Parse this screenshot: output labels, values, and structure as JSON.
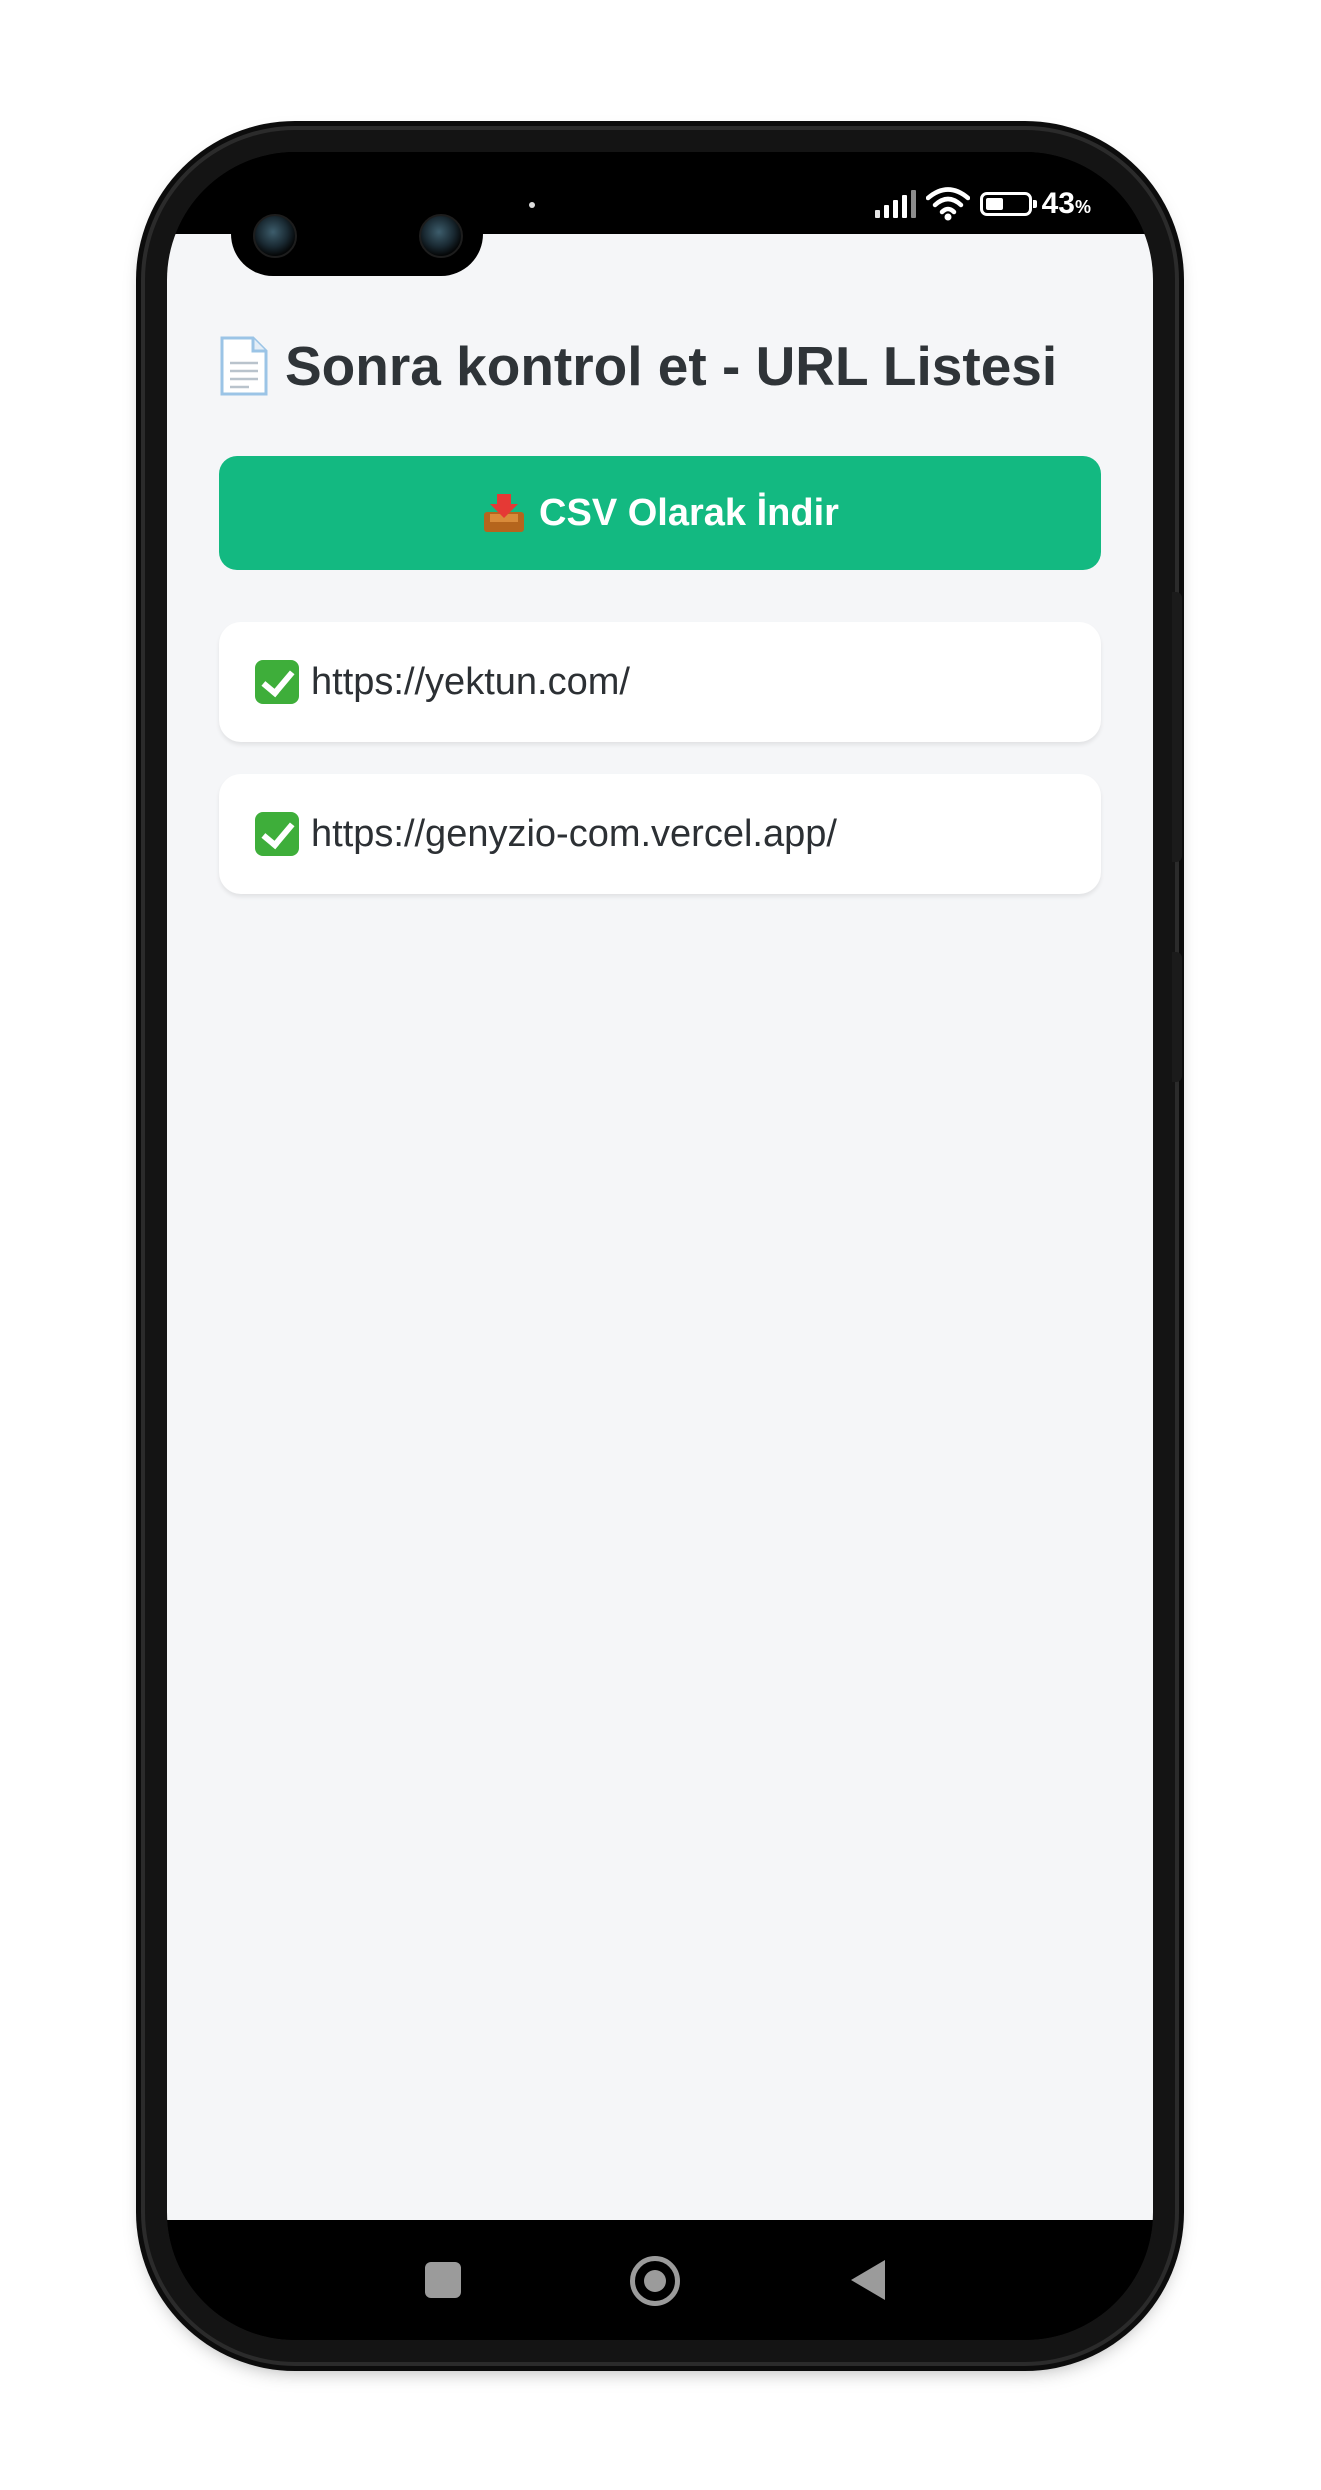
{
  "status_bar": {
    "battery_percent": "43",
    "battery_unit": "%",
    "battery_level": 0.43,
    "icons": [
      "signal-icon",
      "wifi-icon",
      "battery-icon"
    ]
  },
  "header": {
    "icon": "document-icon",
    "title": "Sonra kontrol et - URL Listesi"
  },
  "toolbar": {
    "download_icon": "inbox-tray-icon",
    "download_label": "CSV Olarak İndir"
  },
  "url_list": [
    {
      "icon": "check-mark-icon",
      "url": "https://yektun.com/"
    },
    {
      "icon": "check-mark-icon",
      "url": "https://genyzio-com.vercel.app/"
    }
  ],
  "nav_bar": {
    "icons": [
      "recents-square-icon",
      "home-circle-icon",
      "back-triangle-icon"
    ]
  },
  "colors": {
    "accent": "#13b981",
    "background": "#f5f6f8",
    "card": "#ffffff",
    "check": "#3eae3a"
  }
}
